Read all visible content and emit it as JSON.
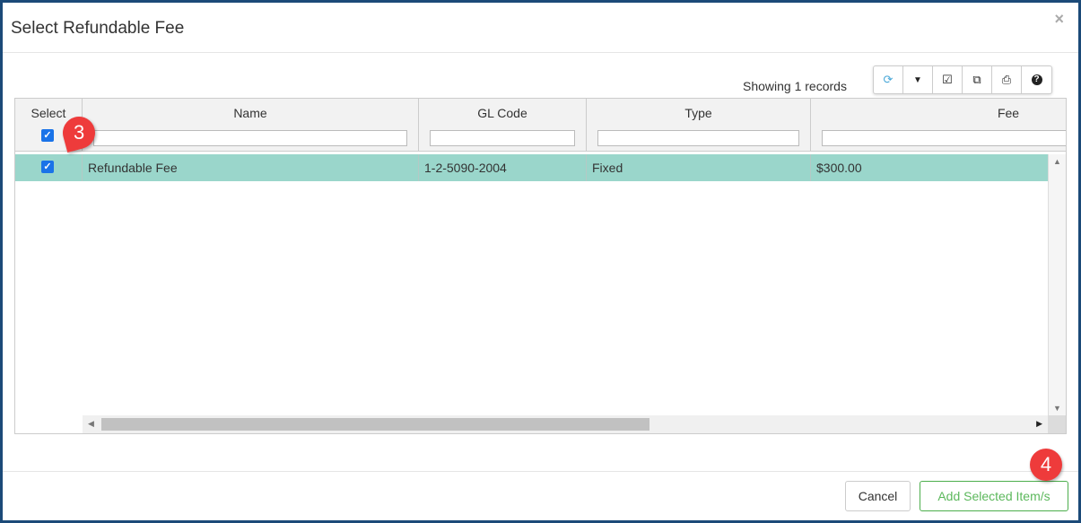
{
  "dialog": {
    "title": "Select Refundable Fee",
    "close_icon": "×"
  },
  "grid": {
    "record_count_text": "Showing 1 records",
    "toolbar": [
      {
        "name": "refresh-icon",
        "glyph": "⟳"
      },
      {
        "name": "filter-icon",
        "glyph": "▼"
      },
      {
        "name": "check-square-icon",
        "glyph": "☑"
      },
      {
        "name": "copy-icon",
        "glyph": "⧉"
      },
      {
        "name": "print-icon",
        "glyph": "⎙"
      },
      {
        "name": "help-icon",
        "glyph": "?"
      }
    ],
    "columns": [
      "Select",
      "Name",
      "GL Code",
      "Type",
      "Fee"
    ],
    "rows": [
      {
        "selected": true,
        "name": "Refundable Fee",
        "gl_code": "1-2-5090-2004",
        "type": "Fixed",
        "fee": "$300.00"
      }
    ]
  },
  "annotations": {
    "step3": "3",
    "step4": "4"
  },
  "footer": {
    "cancel": "Cancel",
    "add": "Add Selected Item/s"
  },
  "colors": {
    "border": "#1b4a78",
    "row_selected": "#9ad6cb",
    "badge": "#ee3b3b",
    "add_button": "#4cae4c"
  }
}
